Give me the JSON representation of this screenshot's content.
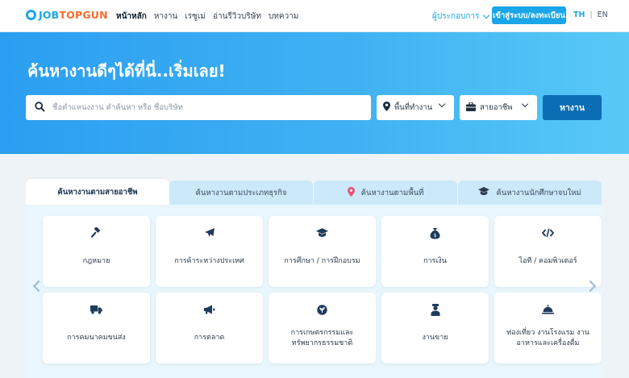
{
  "header": {
    "logo_prefix": "JOB",
    "logo_suffix": "TOPGUN",
    "nav": [
      "หน้าหลัก",
      "หางาน",
      "เรซูเม่",
      "อ่านรีวิวบริษัท",
      "บทความ"
    ],
    "employer_label": "ผู้ประกอบการ",
    "login_label": "เข้าสู่ระบบ/ลงทะเบียน",
    "lang_th": "TH",
    "lang_sep": "|",
    "lang_en": "EN"
  },
  "hero": {
    "title": "ค้นหางานดีๆได้ที่นี่..เริ่มเลย!",
    "search_placeholder": "ชื่อตำแหน่งงาน คำค้นหา หรือ ชื่อบริษัท",
    "area_label": "พื้นที่ทำงาน",
    "career_label": "สายอาชีพ",
    "search_button": "หางาน"
  },
  "tabs": [
    {
      "label": "ค้นหางานตามสายอาชีพ",
      "active": true
    },
    {
      "label": "ค้นหางานตามประเภทธุรกิจ",
      "active": false
    },
    {
      "label": "ค้นหางานตามพื้นที่",
      "active": false,
      "icon": "location-pin-icon"
    },
    {
      "label": "ค้นหางานนักศึกษาจบใหม่",
      "active": false,
      "icon": "graduation-cap-icon"
    }
  ],
  "categories": [
    {
      "label": "กฎหมาย",
      "icon": "gavel-icon"
    },
    {
      "label": "การค้าระหว่างประเทศ",
      "icon": "airplane-icon"
    },
    {
      "label": "การศึกษา / การฝึกอบรม",
      "icon": "graduation-cap-icon"
    },
    {
      "label": "การเงิน",
      "icon": "money-bag-icon"
    },
    {
      "label": "ไอที / คอมพิวเตอร์",
      "icon": "code-icon"
    },
    {
      "label": "การคมนาคมขนส่ง",
      "icon": "truck-icon"
    },
    {
      "label": "การตลาด",
      "icon": "megaphone-icon"
    },
    {
      "label": "การเกษตรกรรมและทรัพยากรธรรมชาติ",
      "line1": "การเกษตรกรรมและ",
      "line2": "ทรัพยากรธรรมชาติ",
      "icon": "leaf-icon"
    },
    {
      "label": "งานขาย",
      "icon": "salesperson-icon"
    },
    {
      "label": "ท่องเที่ยว งานโรงแรม งานอาหารและเครื่องดื่ม",
      "line1": "ท่องเที่ยว งานโรงแรม งาน",
      "line2": "อาหารและเครื่องดื่ม",
      "icon": "cloche-icon"
    }
  ],
  "colors": {
    "brand": "#1aa6e8",
    "brand_dark": "#0b6db4",
    "accent": "#ff6a2b"
  }
}
